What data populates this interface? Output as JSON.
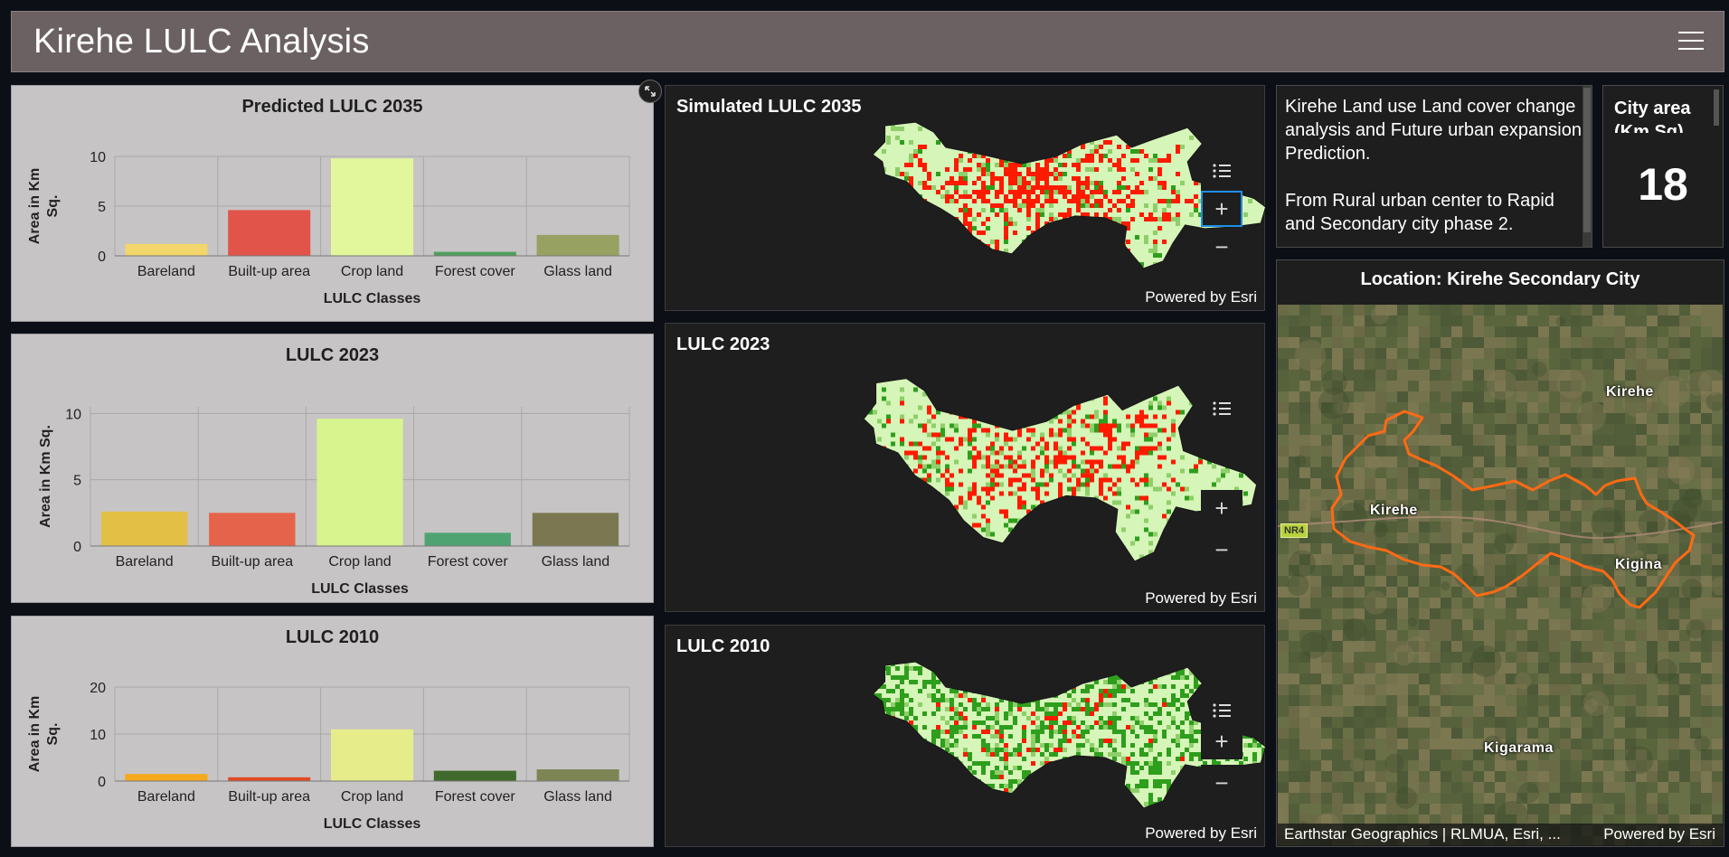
{
  "header": {
    "title": "Kirehe LULC Analysis",
    "menu_icon": "hamburger-icon"
  },
  "charts": [
    {
      "title": "Predicted LULC 2035",
      "xlabel": "LULC Classes",
      "ylabel_lines": [
        "Area in Km",
        "Sq."
      ],
      "chart_data": {
        "type": "bar",
        "title": "Predicted LULC 2035",
        "xlabel": "LULC Classes",
        "ylabel": "Area in Km Sq.",
        "categories": [
          "Bareland",
          "Built-up area",
          "Crop land",
          "Forest cover",
          "Glass land"
        ],
        "values": [
          1.2,
          4.6,
          9.8,
          0.4,
          2.1
        ],
        "colors": [
          "#f2d56b",
          "#e0544a",
          "#e2f79b",
          "#4f9e5c",
          "#97a161"
        ],
        "yticks": [
          0,
          5,
          10
        ],
        "ylim": [
          0,
          10
        ],
        "grid": true
      }
    },
    {
      "title": "LULC 2023",
      "xlabel": "LULC Classes",
      "ylabel_lines": [
        "Area in Km Sq."
      ],
      "chart_data": {
        "type": "bar",
        "title": "LULC 2023",
        "xlabel": "LULC Classes",
        "ylabel": "Area in Km Sq.",
        "categories": [
          "Bareland",
          "Built-up area",
          "Crop land",
          "Forest cover",
          "Glass land"
        ],
        "values": [
          2.6,
          2.5,
          9.6,
          1.0,
          2.5
        ],
        "colors": [
          "#e3c045",
          "#e5634a",
          "#d8f48e",
          "#4fa373",
          "#7b7851"
        ],
        "yticks": [
          0,
          5,
          10
        ],
        "ylim": [
          0,
          10.5
        ],
        "grid": true
      }
    },
    {
      "title": "LULC 2010",
      "xlabel": "LULC Classes",
      "ylabel_lines": [
        "Area in Km",
        "Sq."
      ],
      "chart_data": {
        "type": "bar",
        "title": "LULC 2010",
        "xlabel": "LULC Classes",
        "ylabel": "Area in Km Sq.",
        "categories": [
          "Bareland",
          "Built-up area",
          "Crop land",
          "Forest cover",
          "Glass land"
        ],
        "values": [
          1.5,
          0.8,
          11.0,
          2.2,
          2.5
        ],
        "colors": [
          "#f5a81c",
          "#e04a22",
          "#e7ec8a",
          "#3f6a2c",
          "#7d8555"
        ],
        "yticks": [
          0,
          10,
          20
        ],
        "ylim": [
          0,
          20
        ],
        "grid": true
      }
    }
  ],
  "maps": [
    {
      "title": "Simulated LULC 2035",
      "powered": "Powered by Esri",
      "seed": 1,
      "red_density": 0.55,
      "dark_density": 0.05
    },
    {
      "title": "LULC 2023",
      "powered": "Powered by Esri",
      "seed": 2,
      "red_density": 0.35,
      "dark_density": 0.06
    },
    {
      "title": "LULC 2010",
      "powered": "Powered by Esri",
      "seed": 3,
      "red_density": 0.12,
      "dark_density": 0.3
    }
  ],
  "map_controls": {
    "zoom_in": "+",
    "zoom_out": "−",
    "legend_icon": "legend-list-icon"
  },
  "description": {
    "line1": "Kirehe Land use Land cover change analysis and Future urban expansion Prediction.",
    "line2": "From Rural urban center to Rapid and Secondary city phase 2."
  },
  "kpi": {
    "title": "City area (Km Sq)",
    "value": "18"
  },
  "location": {
    "title": "Location: Kirehe Secondary City",
    "labels": {
      "kirehe_ne": "Kirehe",
      "kirehe": "Kirehe",
      "kigina": "Kigina",
      "kigarama": "Kigarama"
    },
    "road": "NR4",
    "attribution": "Earthstar Geographics | RLMUA, Esri, ...",
    "powered": "Powered by Esri"
  },
  "colors": {
    "accent": "#1e8ee6",
    "boundary": "#ff6a13",
    "header_bg": "#6b6163"
  }
}
